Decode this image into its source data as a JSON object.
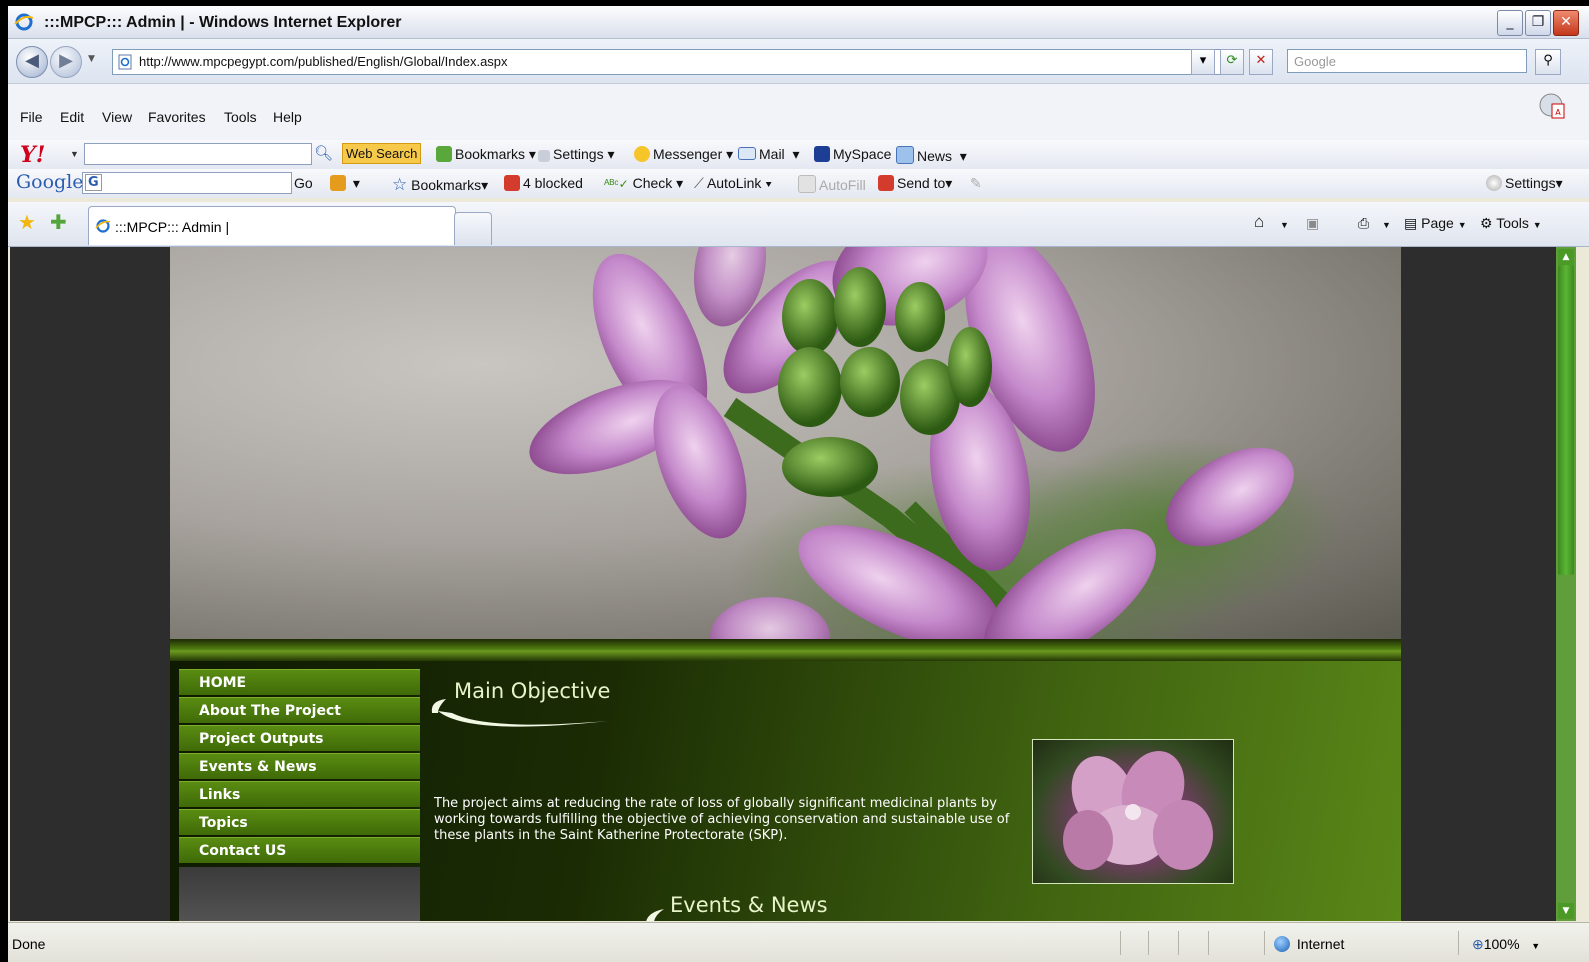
{
  "window": {
    "title": ":::MPCP::: Admin |  - Windows Internet Explorer",
    "minimize": "_",
    "restore": "❐",
    "close": "✕"
  },
  "address_bar": {
    "url": "http://www.mpcpegypt.com/published/English/Global/Index.aspx",
    "search_placeholder": "Google"
  },
  "menu": [
    "File",
    "Edit",
    "View",
    "Favorites",
    "Tools",
    "Help"
  ],
  "yahoo_toolbar": {
    "logo": "Y!",
    "web_search": "Web Search",
    "bookmarks": "Bookmarks",
    "settings": "Settings",
    "messenger": "Messenger",
    "mail": "Mail",
    "myspace": "MySpace",
    "news": "News"
  },
  "google_toolbar": {
    "logo": "Google",
    "go": "Go",
    "bookmarks": "Bookmarks",
    "blocked": "4 blocked",
    "check": "Check",
    "autolink": "AutoLink",
    "autofill": "AutoFill",
    "send_to": "Send to",
    "settings": "Settings"
  },
  "tabs": {
    "active_title": ":::MPCP::: Admin |",
    "page": "Page",
    "tools": "Tools"
  },
  "site": {
    "nav": [
      "HOME",
      "About The Project",
      "Project Outputs",
      "Events & News",
      "Links",
      "Topics",
      "Contact US"
    ],
    "main_heading": "Main Objective",
    "description": "The project aims at reducing the rate of loss of globally significant medicinal plants by working towards fulfilling the objective of achieving conservation and sustainable use of these plants in the Saint Katherine Protectorate (SKP).",
    "events_heading": "Events & News"
  },
  "status_bar": {
    "status": "Done",
    "zone": "Internet",
    "zoom": "100%"
  },
  "colors": {
    "nav_green": "#4f7e0e",
    "accent_green": "#5a8718",
    "flower_pink": "#c58acb"
  }
}
